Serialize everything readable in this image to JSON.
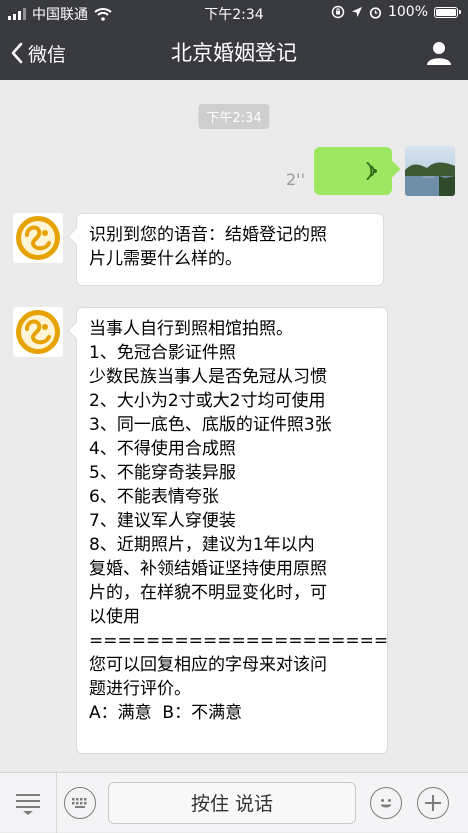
{
  "status_bar": {
    "carrier": "中国联通",
    "time": "下午2:34",
    "battery": "100%",
    "battery_level": 1.0
  },
  "nav": {
    "back_label": "微信",
    "title": "北京婚姻登记"
  },
  "chat": {
    "timestamp": "下午2:34",
    "voice_message": {
      "duration": "2''"
    },
    "messages": [
      {
        "text": "识别到您的语音：结婚登记的照\n片儿需要什么样的。"
      },
      {
        "text": "当事人自行到照相馆拍照。\n1、免冠合影证件照\n少数民族当事人是否免冠从习惯\n2、大小为2寸或大2寸均可使用\n3、同一底色、底版的证件照3张\n4、不得使用合成照\n5、不能穿奇装异服\n6、不能表情夸张\n7、建议军人穿便装\n8、近期照片，建议为1年以内\n复婚、补领结婚证坚持使用原照\n片的，在样貌不明显变化时，可\n以使用\n=====================\n您可以回复相应的字母来对该问\n题进行评价。\nA：满意  B：不满意"
      }
    ]
  },
  "input_bar": {
    "hold_to_talk_label": "按住 说话"
  },
  "colors": {
    "nav_bg": "#393a3f",
    "chat_bg": "#ebebeb",
    "voice_bubble": "#9ee861",
    "bot_avatar_accent": "#e6a300"
  }
}
